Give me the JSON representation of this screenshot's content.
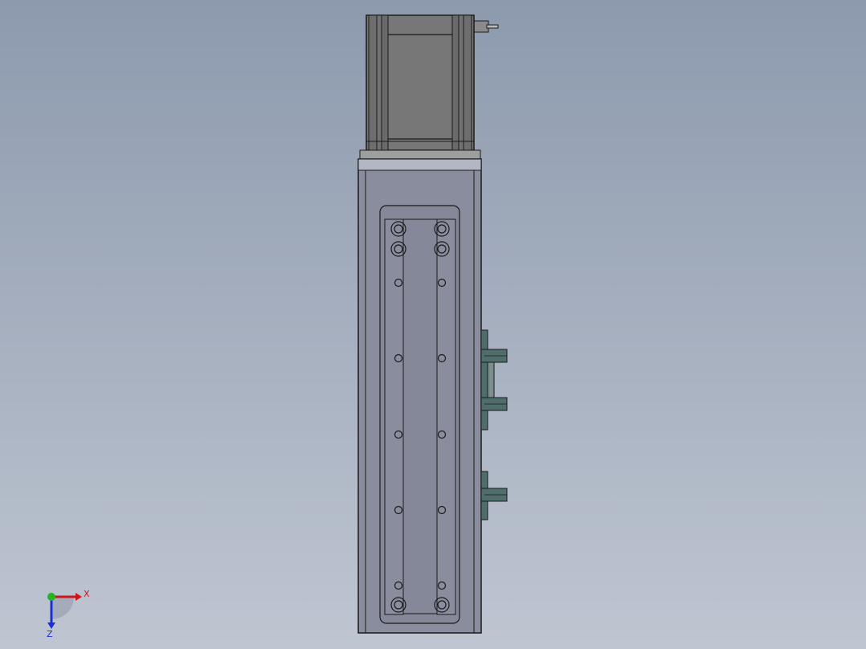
{
  "viewport": {
    "background_top": "#8d9aae",
    "background_bottom": "#bfc6d2"
  },
  "model": {
    "motor_color": "#777777",
    "motor_edge": "#1a1a1a",
    "adapter_color": "#9e9e9e",
    "body_color": "#8a8d9e",
    "plate_color": "#858899",
    "bracket_color": "#4e6d6b"
  },
  "triad": {
    "x_label": "X",
    "z_label": "Z",
    "x_color": "#d0141b",
    "y_color": "#26b326",
    "z_color": "#1a2fd6"
  }
}
